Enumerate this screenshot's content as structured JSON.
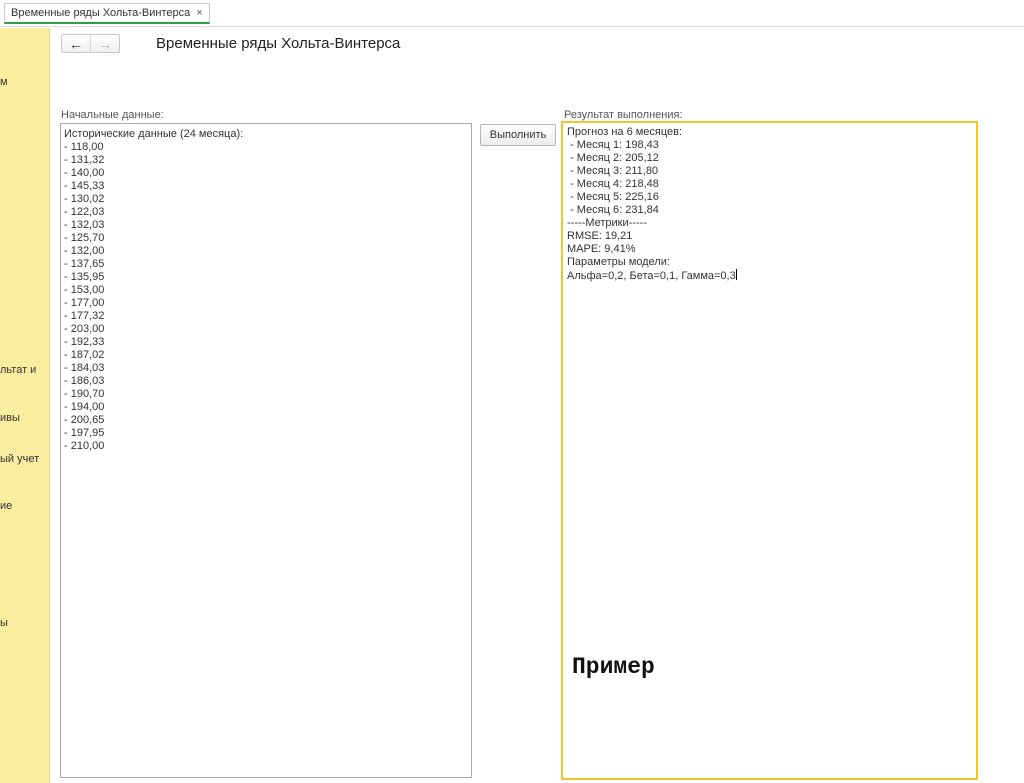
{
  "tab": {
    "title": "Временные ряды Хольта-Винтерса",
    "close": "×"
  },
  "sidebar": {
    "items": [
      {
        "label": "м"
      },
      {
        "label": "льтат и"
      },
      {
        "label": "ивы"
      },
      {
        "label": "ый учет"
      },
      {
        "label": "ие"
      },
      {
        "label": "ы"
      }
    ]
  },
  "nav": {
    "back": "←",
    "forward": "→"
  },
  "page": {
    "title": "Временные ряды Хольта-Винтерса"
  },
  "input": {
    "label": "Начальные данные:",
    "header": "Исторические данные (24 месяца):",
    "values": [
      "118,00",
      "131,32",
      "140,00",
      "145,33",
      "130,02",
      "122,03",
      "132,03",
      "125,70",
      "132,00",
      "137,65",
      "135,95",
      "153,00",
      "177,00",
      "177,32",
      "203,00",
      "192,33",
      "187,02",
      "184,03",
      "186,03",
      "190,70",
      "194,00",
      "200,65",
      "197,95",
      "210,00"
    ]
  },
  "run_button": {
    "label": "Выполнить"
  },
  "output": {
    "label": "Результат выполнения:",
    "lines": [
      "Прогноз на 6 месяцев:",
      " - Месяц 1: 198,43",
      " - Месяц 2: 205,12",
      " - Месяц 3: 211,80",
      " - Месяц 4: 218,48",
      " - Месяц 5: 225,16",
      " - Месяц 6: 231,84",
      "-----Метрики-----",
      "RMSE: 19,21",
      "MAPE: 9,41%",
      "Параметры модели:",
      "Альфа=0,2, Бета=0,1, Гамма=0,3"
    ]
  },
  "watermark": "Пример",
  "colors": {
    "sidebar": "#fbeda0",
    "active_border": "#f4c430",
    "tab_underline": "#2e9c48"
  }
}
